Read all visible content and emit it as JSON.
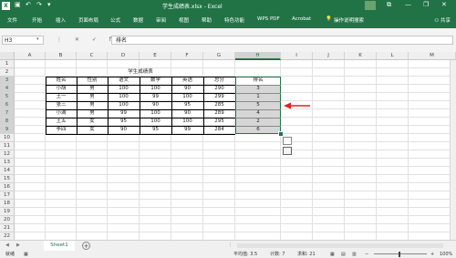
{
  "window": {
    "title": "学生成绩表.xlsx - Excel",
    "app_icon": "X",
    "quick_access": [
      "save-icon",
      "undo-icon",
      "redo-icon",
      "customize-icon"
    ]
  },
  "ribbon": {
    "tabs": [
      "文件",
      "开始",
      "插入",
      "页面布局",
      "公式",
      "数据",
      "审阅",
      "视图",
      "帮助",
      "特色功能",
      "WPS PDF",
      "Acrobat",
      "操作说明搜索"
    ],
    "share": "共享"
  },
  "formula_bar": {
    "name_box": "H3",
    "content": "排名",
    "icons": "⋮ ✕ ✓ fx"
  },
  "sheet": {
    "columns": [
      "A",
      "B",
      "C",
      "D",
      "E",
      "F",
      "G",
      "H",
      "I",
      "J",
      "K",
      "L",
      "M"
    ],
    "rows": [
      "1",
      "2",
      "3",
      "4",
      "5",
      "6",
      "7",
      "8",
      "9",
      "10",
      "11",
      "12",
      "13",
      "14",
      "15",
      "16",
      "17",
      "18",
      "19",
      "20",
      "21",
      "22"
    ],
    "title": "学生成绩表",
    "headers": [
      "姓名",
      "性别",
      "语文",
      "数学",
      "英语",
      "总分"
    ],
    "rank_header": "排名",
    "records": [
      [
        "小胡",
        "男",
        "100",
        "100",
        "90",
        "290"
      ],
      [
        "王一",
        "男",
        "100",
        "99",
        "100",
        "299"
      ],
      [
        "张三",
        "男",
        "100",
        "90",
        "95",
        "285"
      ],
      [
        "小满",
        "男",
        "99",
        "100",
        "90",
        "289"
      ],
      [
        "王五",
        "女",
        "95",
        "100",
        "100",
        "295"
      ],
      [
        "李四",
        "女",
        "90",
        "95",
        "99",
        "284"
      ]
    ],
    "ranks": [
      "3",
      "1",
      "5",
      "4",
      "2",
      "6"
    ]
  },
  "tabs": {
    "sheet1": "Sheet1",
    "add": "+"
  },
  "status": {
    "mode": "就绪",
    "average": "平均值: 3.5",
    "count": "计数: 7",
    "sum": "求和: 21",
    "zoom": "100%"
  },
  "colors": {
    "excel_green": "#217346",
    "arrow_red": "#e02020"
  }
}
